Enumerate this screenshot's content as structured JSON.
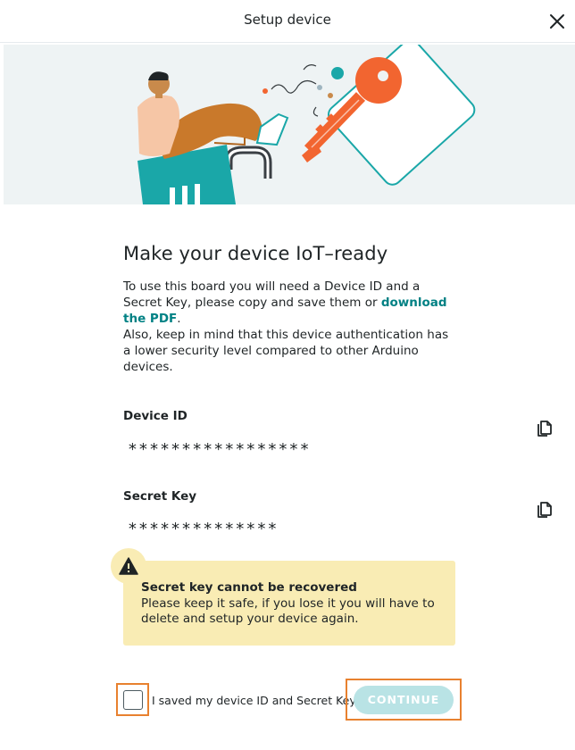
{
  "header": {
    "title": "Setup device",
    "close_icon": "close-icon"
  },
  "hero": {
    "illustration": "person-sitting-on-padlock-with-key-illustration"
  },
  "main": {
    "title": "Make your device IoT–ready",
    "desc_part1": "To use this board you will need a Device ID and a Secret Key, please copy and save them or ",
    "desc_link": "download the PDF",
    "desc_part2": ".",
    "desc_line2": "Also, keep in mind that this device authentication has a lower security level compared to other Arduino devices."
  },
  "device_id": {
    "label": "Device ID",
    "value": "*****************",
    "copy_icon": "copy-icon"
  },
  "secret_key": {
    "label": "Secret Key",
    "value": "**************",
    "copy_icon": "copy-icon"
  },
  "alert": {
    "icon": "warning-icon",
    "title": "Secret key cannot be recovered",
    "text": "Please keep it safe, if you lose it you will have to delete and setup your device again."
  },
  "footer": {
    "checkbox_label": "I saved my device ID and Secret Key",
    "checkbox_checked": false,
    "continue_label": "CONTINUE",
    "continue_enabled": false
  },
  "colors": {
    "accent": "#008184",
    "alert_bg": "#f9ecb4",
    "button_disabled": "#b9e3e5",
    "focus_outline": "#e8812f"
  }
}
